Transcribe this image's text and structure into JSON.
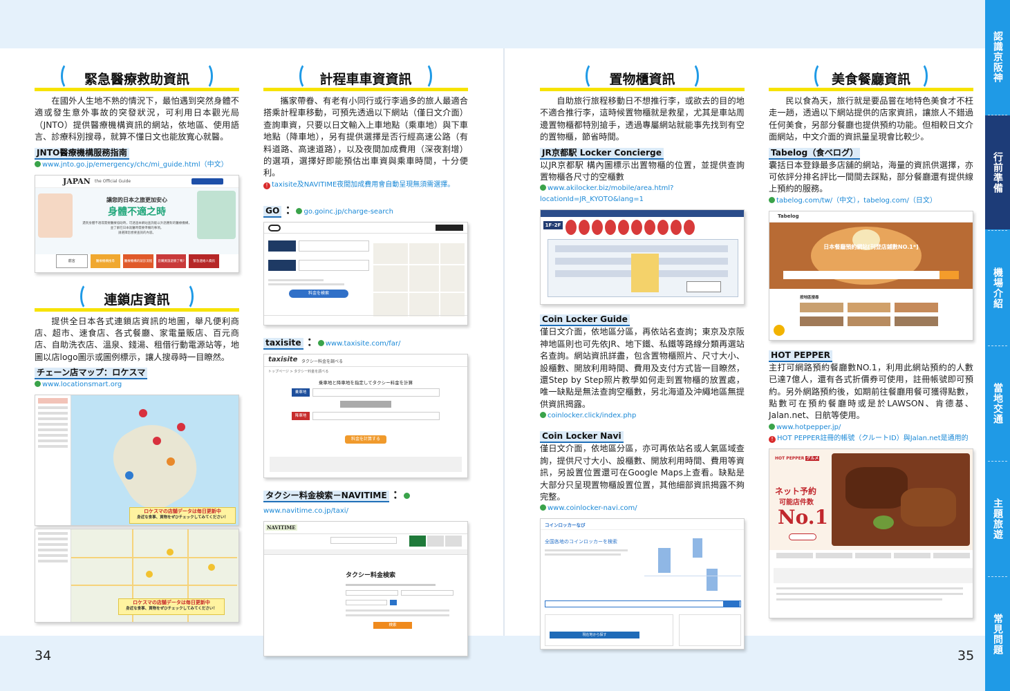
{
  "page_numbers": {
    "left": "34",
    "right": "35"
  },
  "side_tabs": [
    "認識京阪神",
    "行前準備",
    "機場介紹",
    "當地交通",
    "主題旅遊",
    "常見問題"
  ],
  "medical": {
    "title": "緊急醫療救助資訊",
    "body": "在國外人生地不熟的情況下，最怕遇到突然身體不適或發生意外事故的突發狀況，可利用日本觀光局（JNTO）提供醫療機構資訊的網站，依地區、使用語言、診療科別搜尋，就算不懂日文也能放寬心就醫。",
    "label": "JNTO醫療機構服務指南",
    "url": "www.jnto.go.jp/emergency/chc/mi_guide.html（中文）",
    "shot": {
      "logo": "JAPAN",
      "logo_sub": "the Official Guide",
      "line1": "讓您的日本之旅更加安心",
      "headline": "身體不適之時",
      "desc": [
        "遇到身體不適或需要醫療協助時，可透過本網站查詢能以外語應對的醫療機構，",
        "並了解在日本就醫時需要準備的事項。",
        "請選擇您想要查詢的內容。"
      ],
      "buttons": [
        "前言",
        "醫療機構搜尋",
        "醫療機構的就診流程",
        "您購買旅遊險了嗎?",
        "緊急連絡人資訊"
      ]
    }
  },
  "chain": {
    "title": "連鎖店資訊",
    "body": "提供全日本各式連鎖店資訊的地圖，舉凡便利商店、超市、速食店、各式餐廳、家電量販店、百元商店、自助洗衣店、溫泉、錢湯、租借行動電源站等，地圖以店logo圖示或圖例標示，讓人搜尋時一目瞭然。",
    "label": "チェーン店マップ：ロケスマ",
    "url": "www.locationsmart.org",
    "banner1": "ロケスマの店舗データは毎日更新中",
    "banner1_sub": "身近な食事、買物をぜひチェックしてみてください！",
    "banner2": "ロケスマの店舗データは毎日更新中",
    "banner2_sub": "身近な食事、買物をぜひチェックしてみてください！"
  },
  "taxi": {
    "title": "計程車車資資訊",
    "body": "攜家帶眷、有老有小同行或行李過多的旅人最適合搭乘計程車移動，可預先透過以下網站（僅日文介面）查詢車資，只要以日文輸入上車地點（乘車地）與下車地點（降車地），另有提供選擇是否行經高速公路（有料道路、高速道路），以及夜間加成費用（深夜割增）的選項，選擇好即能預估出車資與乘車時間，十分便利。",
    "note": "taxisite及NAVITIME夜間加成費用會自動呈現無須需選擇。",
    "go_label": "GO",
    "go_url": "go.goinc.jp/charge-search",
    "go_btn": "料金を検索",
    "taxisite_label": "taxisite",
    "taxisite_url": "www.taxisite.com/far/",
    "taxisite_logo": "taxisite",
    "taxisite_header": "タクシー料金を調べる",
    "taxisite_crumb": "トップページ > タクシー料金を調べる",
    "taxisite_heading": "乗車地と降車地を指定してタクシー料金を計算",
    "taxisite_from": "乗車地",
    "taxisite_to": "降車地",
    "taxisite_btn": "料金を計算する",
    "navitime_label": "タクシー料金検索－NAVITIME",
    "navitime_url": "www.navitime.co.jp/taxi/",
    "navitime_logo": "NAVITIME",
    "navitime_heading": "タクシー料金検索",
    "navitime_btn": "検索"
  },
  "locker": {
    "title": "置物櫃資訊",
    "body": "自助旅行旅程移動日不想推行李，或欲去的目的地不適合推行李，這時候置物櫃就是救星，尤其是車站周邊置物櫃都特別搶手，透過專屬網站就能事先找到有空的置物櫃，節省時間。",
    "label1": "JR京都駅 Locker Concierge",
    "body1": "以JR京都駅 構內圖標示出置物櫃的位置，並提供查詢置物櫃各尺寸的空櫃數",
    "url1": "www.akilocker.biz/mobile/area.html?locationId=JR_KYOTO&lang=1",
    "floor": "1F･2F",
    "label2": "Coin Locker Guide",
    "body2": "僅日文介面，依地區分區，再依站名查詢；東京及京阪神地區則也可先依JR、地下鐵、私鐵等路線分類再選站名查詢。網站資訊詳盡，包含置物櫃照片、尺寸大小、設櫃數、開放利用時間、費用及支付方式皆一目瞭然，還Step by Step照片教學如何走到置物櫃的放置處，唯一缺點是無法查詢空櫃數，另北海道及沖繩地區無提供資訊揭露。",
    "url2": "coinlocker.click/index.php",
    "label3": "Coin Locker Navi",
    "body3": "僅日文介面，依地區分區，亦可再依站名或人氣區域查詢，提供尺寸大小、設櫃數、開放利用時間、費用等資訊，另設置位置還可在Google Maps上查看。缺點是大部分只呈現置物櫃設置位置，其他細部資訊揭露不夠完整。",
    "url3": "www.coinlocker-navi.com/",
    "navi_logo": "コインロッカーなび",
    "navi_heading": "全国各地のコインロッカーを検索",
    "navi_btn": "現在地から探す"
  },
  "food": {
    "title": "美食餐廳資訊",
    "body": "民以食為天，旅行就是要品嘗在地特色美食才不枉走一趟，透過以下網站提供的店家資訊，讓旅人不錯過任何美食，另部分餐廳也提供預約功能。但相較日文介面網站，中文介面的資訊量呈現會比較少。",
    "label1": "Tabelog（食べログ）",
    "body1": "囊括日本登錄最多店舖的網站，海量的資訊供選擇，亦可依評分排名評比一間間去踩點，部分餐廳還有提供線上預約的服務。",
    "url1": "tabelog.com/tw/（中文），tabelog.com/（日文）",
    "tabelog_logo": "Tabelog",
    "tabelog_headline": "日本餐廳預約網站[刊登店鋪數NO.1*]",
    "tabelog_section": "按地區搜尋",
    "label2": "HOT PEPPER",
    "body2": "主打可網路預約餐廳數NO.1，利用此網站預約的人數已達7億人，還有各式折價券可使用，註冊帳號即可預約。另外網路預約後，如期前往餐廳用餐可獲得點數，點數可在預約餐廳時或是於LAWSON、肯德基、Jalan.net、日航等使用。",
    "url2": "www.hotpepper.jp/",
    "note2": "HOT PEPPER註冊的帳號（クルートID）與Jalan.net是通用的",
    "hp_logo": "HOT PEPPER",
    "hp_logo2": "グルメ",
    "hp_catch": "ネット予約",
    "hp_catch2": "可能店件数",
    "hp_no1": "No.1"
  },
  "colors": {
    "accent": "#1f9ae6",
    "tab_active": "#1d3c78",
    "highlight": "#f7e300",
    "link": "#1a88d6"
  }
}
